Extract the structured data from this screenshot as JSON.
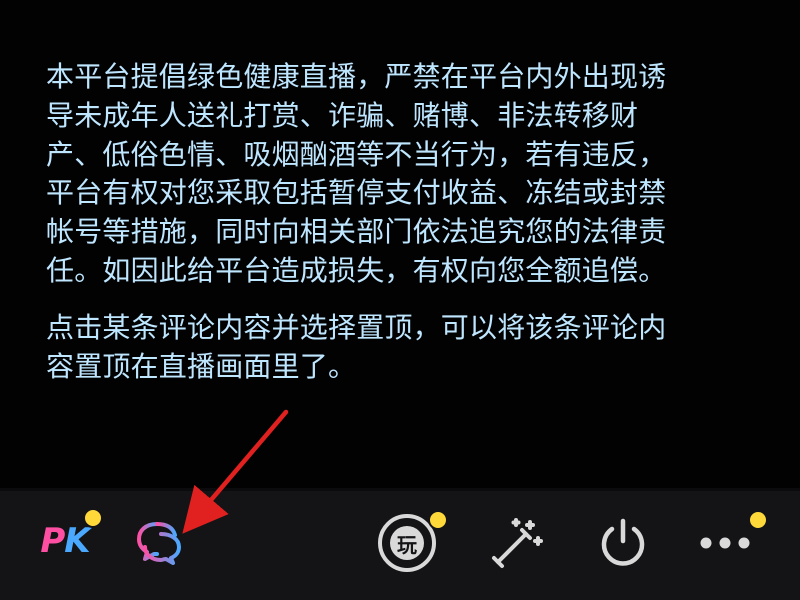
{
  "notice": {
    "paragraph1_lines": [
      "本平台提倡绿色健康直播，严禁在平台内外出现诱",
      "导未成年人送礼打赏、诈骗、赌博、非法转移财",
      "产、低俗色情、吸烟酗酒等不当行为，若有违反，",
      "平台有权对您采取包括暂停支付收益、冻结或封禁",
      "帐号等措施，同时向相关部门依法追究您的法律责",
      "任。如因此给平台造成损失，有权向您全额追偿。"
    ],
    "paragraph2_lines": [
      "点击某条评论内容并选择置顶，可以将该条评论内",
      "容置顶在直播画面里了。"
    ]
  },
  "toolbar": {
    "pk_label_p": "P",
    "pk_label_k": "K",
    "play_label": "玩",
    "icons": {
      "pk": "pk-icon",
      "comment": "comment-bubbles-icon",
      "play": "play-badge-icon",
      "magic": "magic-wand-icon",
      "power": "power-icon",
      "more": "more-dots-icon"
    },
    "badges": {
      "pk": true,
      "play": true,
      "more": true
    }
  },
  "colors": {
    "text": "#bfe6ff",
    "badge": "#ffd93a",
    "arrow": "#e0211f",
    "toolbar_bg": "#141417",
    "pk_p": "#ff4fa3",
    "pk_k": "#4aa9ff"
  }
}
